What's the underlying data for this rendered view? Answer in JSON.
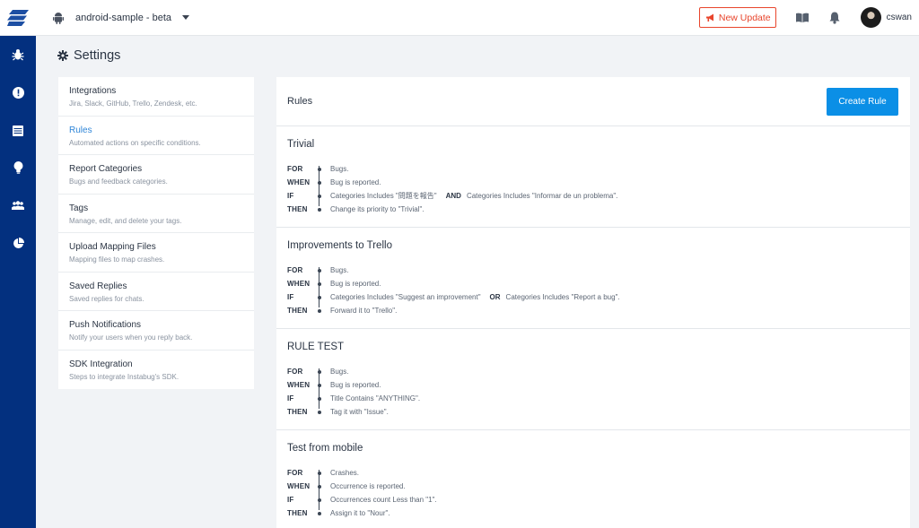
{
  "topbar": {
    "app_name": "android-sample - beta",
    "new_update_label": "New Update",
    "username": "cswan"
  },
  "sidebar": {
    "icons": [
      "bug-icon",
      "alert-icon",
      "calendar-icon",
      "bulb-icon",
      "users-icon",
      "pie-chart-icon"
    ]
  },
  "page": {
    "title": "Settings"
  },
  "menu": {
    "items": [
      {
        "title": "Integrations",
        "desc": "Jira, Slack, GitHub, Trello, Zendesk, etc."
      },
      {
        "title": "Rules",
        "desc": "Automated actions on specific conditions."
      },
      {
        "title": "Report Categories",
        "desc": "Bugs and feedback categories."
      },
      {
        "title": "Tags",
        "desc": "Manage, edit, and delete your tags."
      },
      {
        "title": "Upload Mapping Files",
        "desc": "Mapping files to map crashes."
      },
      {
        "title": "Saved Replies",
        "desc": "Saved replies for chats."
      },
      {
        "title": "Push Notifications",
        "desc": "Notify your users when you reply back."
      },
      {
        "title": "SDK Integration",
        "desc": "Steps to integrate Instabug's SDK."
      }
    ],
    "active": "Rules"
  },
  "rules_panel": {
    "title": "Rules",
    "create_button": "Create Rule",
    "keywords": {
      "for": "FOR",
      "when": "WHEN",
      "if": "IF",
      "then": "THEN"
    },
    "rules": [
      {
        "name": "Trivial",
        "for": "Bugs.",
        "when": "Bug is reported.",
        "if_a": "Categories Includes \"問題を報告\"",
        "if_op": "AND",
        "if_b": "Categories Includes \"Informar de un problema\".",
        "then": "Change its priority to \"Trivial\"."
      },
      {
        "name": "Improvements to Trello",
        "for": "Bugs.",
        "when": "Bug is reported.",
        "if_a": "Categories Includes \"Suggest an improvement\"",
        "if_op": "OR",
        "if_b": "Categories Includes \"Report a bug\".",
        "then": "Forward it to \"Trello\"."
      },
      {
        "name": "RULE TEST",
        "for": "Bugs.",
        "when": "Bug is reported.",
        "if_a": "Title Contains \"ANYTHING\".",
        "then": "Tag it with \"Issue\"."
      },
      {
        "name": "Test from mobile",
        "for": "Crashes.",
        "when": "Occurrence is reported.",
        "if_a": "Occurrences count Less than \"1\".",
        "then": "Assign it to \"Nour\"."
      }
    ]
  },
  "colors": {
    "sidebar": "#03307f",
    "accent": "#0b8fe6",
    "active_link": "#2f86d8",
    "update_badge": "#e8452c"
  }
}
